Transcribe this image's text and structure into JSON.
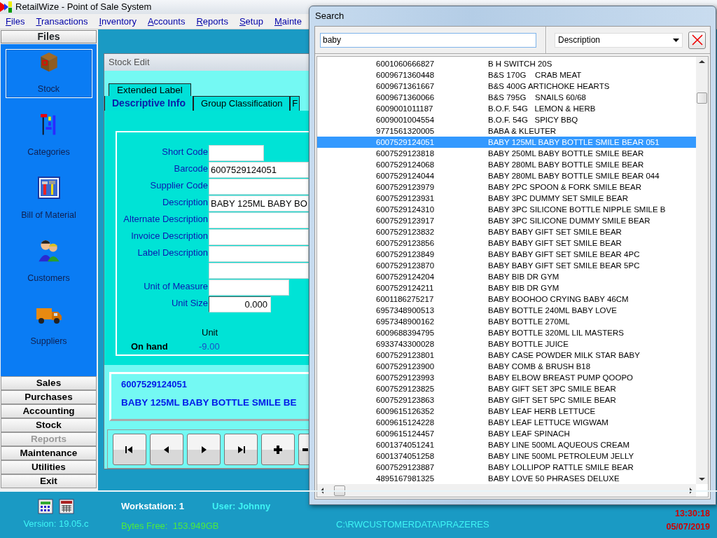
{
  "window": {
    "title": "RetailWize - Point of Sale System"
  },
  "menu": [
    "Files",
    "Transactions",
    "Inventory",
    "Accounts",
    "Reports",
    "Setup",
    "Mainte"
  ],
  "sidebar": {
    "header": "Files",
    "items": [
      {
        "label": "Stock",
        "kind": "box",
        "selected": true
      },
      {
        "label": "Categories",
        "kind": "bars",
        "selected": false
      },
      {
        "label": "Bill of Material",
        "kind": "tools",
        "selected": false
      },
      {
        "label": "Customers",
        "kind": "people",
        "selected": false
      },
      {
        "label": "Suppliers",
        "kind": "truck",
        "selected": false
      }
    ],
    "sections": [
      {
        "label": "Sales",
        "disabled": false
      },
      {
        "label": "Purchases",
        "disabled": false
      },
      {
        "label": "Accounting",
        "disabled": false
      },
      {
        "label": "Stock",
        "disabled": false
      },
      {
        "label": "Reports",
        "disabled": true
      },
      {
        "label": "Maintenance",
        "disabled": false
      },
      {
        "label": "Utilities",
        "disabled": false
      },
      {
        "label": "Exit",
        "disabled": false
      }
    ]
  },
  "stock_edit": {
    "title": "Stock Edit",
    "upper_tabs": [
      {
        "label": "Extended Label",
        "selected": false
      }
    ],
    "tabs": [
      {
        "label": "Descriptive Info",
        "selected": true
      },
      {
        "label": "Group Classification",
        "selected": false
      },
      {
        "label": "F",
        "selected": false
      }
    ],
    "fields": [
      {
        "label": "Short Code",
        "kind": "short"
      },
      {
        "label": "Barcode",
        "kind": "wide",
        "value": "6007529124051"
      },
      {
        "label": "Supplier Code",
        "kind": "wide"
      },
      {
        "label": "Description",
        "kind": "wide",
        "value": "BABY 125ML BABY BO"
      },
      {
        "label": "Alternate Description",
        "kind": "wide"
      },
      {
        "label": "Invoice Description",
        "kind": "wide"
      },
      {
        "label": "Label Description",
        "kind": "wide"
      },
      {
        "kind": "wide"
      },
      {
        "label": "Unit of Measure",
        "kind": "medium"
      },
      {
        "label": "Unit Size",
        "kind": "number",
        "value": "0.000"
      }
    ],
    "on_hand": {
      "label": "On hand",
      "unit_heading": "Unit",
      "value": "-9.00"
    },
    "summary": {
      "barcode": "6007529124051",
      "description": "BABY 125ML BABY BOTTLE SMILE BE"
    },
    "nav_buttons": [
      {
        "kind": "first"
      },
      {
        "kind": "prev"
      },
      {
        "kind": "next"
      },
      {
        "kind": "last"
      },
      {
        "kind": "add"
      },
      {
        "kind": "remove"
      }
    ]
  },
  "search": {
    "title": "Search",
    "query": "baby",
    "field": "Description",
    "rows": [
      {
        "barcode": "6001060666827",
        "description": "B H SWITCH 20S",
        "selected": false
      },
      {
        "barcode": "6009671360448",
        "description": "B&S 170G    CRAB MEAT",
        "selected": false
      },
      {
        "barcode": "6009671361667",
        "description": "B&S 400G ARTICHOKE HEARTS",
        "selected": false
      },
      {
        "barcode": "6009671360066",
        "description": "B&S 795G    SNAILS 60/68",
        "selected": false
      },
      {
        "barcode": "6009001011187",
        "description": "B.O.F. 54G   LEMON & HERB",
        "selected": false
      },
      {
        "barcode": "6009001004554",
        "description": "B.O.F. 54G   SPICY BBQ",
        "selected": false
      },
      {
        "barcode": "9771561320005",
        "description": "BABA & KLEUTER",
        "selected": false
      },
      {
        "barcode": "6007529124051",
        "description": "BABY 125ML BABY BOTTLE SMILE BEAR 051",
        "selected": true
      },
      {
        "barcode": "6007529123818",
        "description": "BABY 250ML BABY BOTTLE SMILE BEAR",
        "selected": false
      },
      {
        "barcode": "6007529124068",
        "description": "BABY 280ML BABY BOTTLE SMILE BEAR",
        "selected": false
      },
      {
        "barcode": "6007529124044",
        "description": "BABY 280ML BABY BOTTLE SMILE BEAR 044",
        "selected": false
      },
      {
        "barcode": "6007529123979",
        "description": "BABY 2PC SPOON & FORK SMILE BEAR",
        "selected": false
      },
      {
        "barcode": "6007529123931",
        "description": "BABY 3PC DUMMY SET SMILE BEAR",
        "selected": false
      },
      {
        "barcode": "6007529124310",
        "description": "BABY 3PC SILICONE BOTTLE NIPPLE SMILE B",
        "selected": false
      },
      {
        "barcode": "6007529123917",
        "description": "BABY 3PC SILICONE DUMMY SMILE BEAR",
        "selected": false
      },
      {
        "barcode": "6007529123832",
        "description": "BABY BABY GIFT SET SMILE BEAR",
        "selected": false
      },
      {
        "barcode": "6007529123856",
        "description": "BABY BABY GIFT SET SMILE BEAR",
        "selected": false
      },
      {
        "barcode": "6007529123849",
        "description": "BABY BABY GIFT SET SMILE BEAR 4PC",
        "selected": false
      },
      {
        "barcode": "6007529123870",
        "description": "BABY BABY GIFT SET SMILE BEAR 5PC",
        "selected": false
      },
      {
        "barcode": "6007529124204",
        "description": "BABY BIB DR GYM",
        "selected": false
      },
      {
        "barcode": "6007529124211",
        "description": "BABY BIB DR GYM",
        "selected": false
      },
      {
        "barcode": "6001186275217",
        "description": "BABY BOOHOO CRYING BABY 46CM",
        "selected": false
      },
      {
        "barcode": "6957348900513",
        "description": "BABY BOTTLE 240ML BABY LOVE",
        "selected": false
      },
      {
        "barcode": "6957348900162",
        "description": "BABY BOTTLE 270ML",
        "selected": false
      },
      {
        "barcode": "6009688394795",
        "description": "BABY BOTTLE 320ML LIL MASTERS",
        "selected": false
      },
      {
        "barcode": "6933743300028",
        "description": "BABY BOTTLE JUICE",
        "selected": false
      },
      {
        "barcode": "6007529123801",
        "description": "BABY CASE POWDER MILK STAR BABY",
        "selected": false
      },
      {
        "barcode": "6007529123900",
        "description": "BABY COMB & BRUSH B18",
        "selected": false
      },
      {
        "barcode": "6007529123993",
        "description": "BABY ELBOW BREAST PUMP QOOPO",
        "selected": false
      },
      {
        "barcode": "6007529123825",
        "description": "BABY GIFT SET 3PC SMILE BEAR",
        "selected": false
      },
      {
        "barcode": "6007529123863",
        "description": "BABY GIFT SET 5PC SMILE BEAR",
        "selected": false
      },
      {
        "barcode": "6009615126352",
        "description": "BABY LEAF HERB LETTUCE",
        "selected": false
      },
      {
        "barcode": "6009615124228",
        "description": "BABY LEAF LETTUCE WIGWAM",
        "selected": false
      },
      {
        "barcode": "6009615124457",
        "description": "BABY LEAF SPINACH",
        "selected": false
      },
      {
        "barcode": "6001374051241",
        "description": "BABY LINE 500ML AQUEOUS CREAM",
        "selected": false
      },
      {
        "barcode": "6001374051258",
        "description": "BABY LINE 500ML PETROLEUM JELLY",
        "selected": false
      },
      {
        "barcode": "6007529123887",
        "description": "BABY LOLLIPOP RATTLE SMILE BEAR",
        "selected": false
      },
      {
        "barcode": "4895167981325",
        "description": "BABY LOVE 50 PHRASES DELUXE",
        "selected": false
      }
    ]
  },
  "status_bar": {
    "version": "Version: 19.05.c",
    "workstation": "Workstation: 1",
    "user": "User: Johnny",
    "bytes_free": "Bytes Free:  153.949GB",
    "path": "C:\\RWCUSTOMERDATA\\PRAZERES",
    "time": "13:30:18",
    "date": "05/07/2019"
  }
}
